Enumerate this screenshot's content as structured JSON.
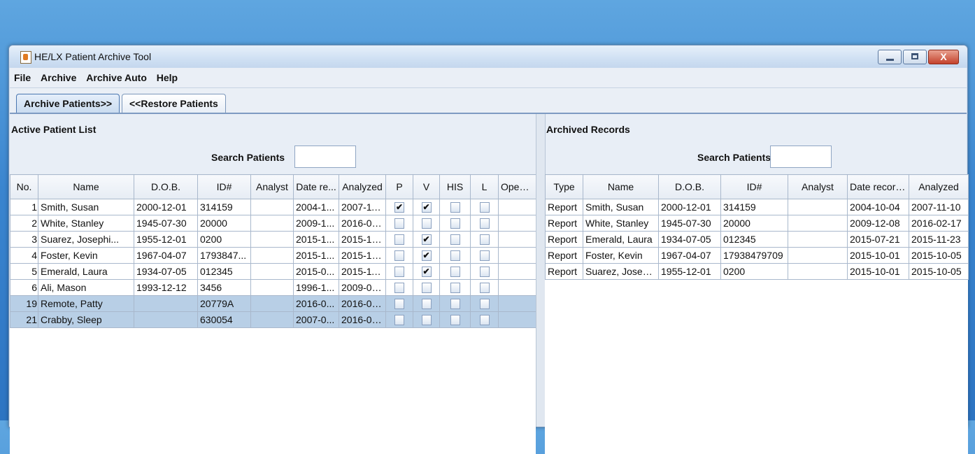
{
  "window": {
    "title": "HE/LX Patient Archive Tool"
  },
  "menu": [
    "File",
    "Archive",
    "Archive Auto",
    "Help"
  ],
  "tabs": [
    "Archive Patients>>",
    "<<Restore Patients"
  ],
  "active_list": {
    "title": "Active Patient List",
    "search_label": "Search Patients",
    "search_value": "",
    "columns": [
      "No.",
      "Name",
      "D.O.B.",
      "ID#",
      "Analyst",
      "Date re...",
      "Analyzed",
      "P",
      "V",
      "HIS",
      "L",
      "Opene..."
    ],
    "rows": [
      {
        "no": "1",
        "name": "Smith, Susan",
        "dob": "2000-12-01",
        "id": "314159",
        "analyst": "",
        "date": "2004-1...",
        "analyzed": "2007-11...",
        "p": true,
        "v": true,
        "his": false,
        "l": false,
        "opened": "",
        "selected": false
      },
      {
        "no": "2",
        "name": "White, Stanley",
        "dob": "1945-07-30",
        "id": "20000",
        "analyst": "",
        "date": "2009-1...",
        "analyzed": "2016-02...",
        "p": false,
        "v": false,
        "his": false,
        "l": false,
        "opened": "",
        "selected": false
      },
      {
        "no": "3",
        "name": "Suarez, Josephi...",
        "dob": "1955-12-01",
        "id": "0200",
        "analyst": "",
        "date": "2015-1...",
        "analyzed": "2015-10...",
        "p": false,
        "v": true,
        "his": false,
        "l": false,
        "opened": "",
        "selected": false
      },
      {
        "no": "4",
        "name": "Foster, Kevin",
        "dob": "1967-04-07",
        "id": "1793847...",
        "analyst": "",
        "date": "2015-1...",
        "analyzed": "2015-10...",
        "p": false,
        "v": true,
        "his": false,
        "l": false,
        "opened": "",
        "selected": false
      },
      {
        "no": "5",
        "name": "Emerald, Laura",
        "dob": "1934-07-05",
        "id": "012345",
        "analyst": "",
        "date": "2015-0...",
        "analyzed": "2015-11...",
        "p": false,
        "v": true,
        "his": false,
        "l": false,
        "opened": "",
        "selected": false
      },
      {
        "no": "6",
        "name": "Ali, Mason",
        "dob": "1993-12-12",
        "id": "3456",
        "analyst": "",
        "date": "1996-1...",
        "analyzed": "2009-01...",
        "p": false,
        "v": false,
        "his": false,
        "l": false,
        "opened": "",
        "selected": false
      },
      {
        "no": "19",
        "name": "Remote, Patty",
        "dob": "",
        "id": "20779A",
        "analyst": "",
        "date": "2016-0...",
        "analyzed": "2016-02...",
        "p": false,
        "v": false,
        "his": false,
        "l": false,
        "opened": "",
        "selected": true
      },
      {
        "no": "21",
        "name": "Crabby, Sleep",
        "dob": "",
        "id": "630054",
        "analyst": "",
        "date": "2007-0...",
        "analyzed": "2016-02...",
        "p": false,
        "v": false,
        "his": false,
        "l": false,
        "opened": "",
        "selected": true
      }
    ]
  },
  "archived": {
    "title": "Archived Records",
    "search_label": "Search Patients",
    "search_value": "",
    "columns": [
      "Type",
      "Name",
      "D.O.B.",
      "ID#",
      "Analyst",
      "Date record...",
      "Analyzed"
    ],
    "rows": [
      {
        "type": "Report",
        "name": "Smith, Susan",
        "dob": "2000-12-01",
        "id": "314159",
        "analyst": "",
        "date": "2004-10-04",
        "analyzed": "2007-11-10"
      },
      {
        "type": "Report",
        "name": "White, Stanley",
        "dob": "1945-07-30",
        "id": "20000",
        "analyst": "",
        "date": "2009-12-08",
        "analyzed": "2016-02-17"
      },
      {
        "type": "Report",
        "name": "Emerald, Laura",
        "dob": "1934-07-05",
        "id": "012345",
        "analyst": "",
        "date": "2015-07-21",
        "analyzed": "2015-11-23"
      },
      {
        "type": "Report",
        "name": "Foster, Kevin",
        "dob": "1967-04-07",
        "id": "17938479709",
        "analyst": "",
        "date": "2015-10-01",
        "analyzed": "2015-10-05"
      },
      {
        "type": "Report",
        "name": "Suarez, Joseph...",
        "dob": "1955-12-01",
        "id": "0200",
        "analyst": "",
        "date": "2015-10-01",
        "analyzed": "2015-10-05"
      }
    ]
  }
}
